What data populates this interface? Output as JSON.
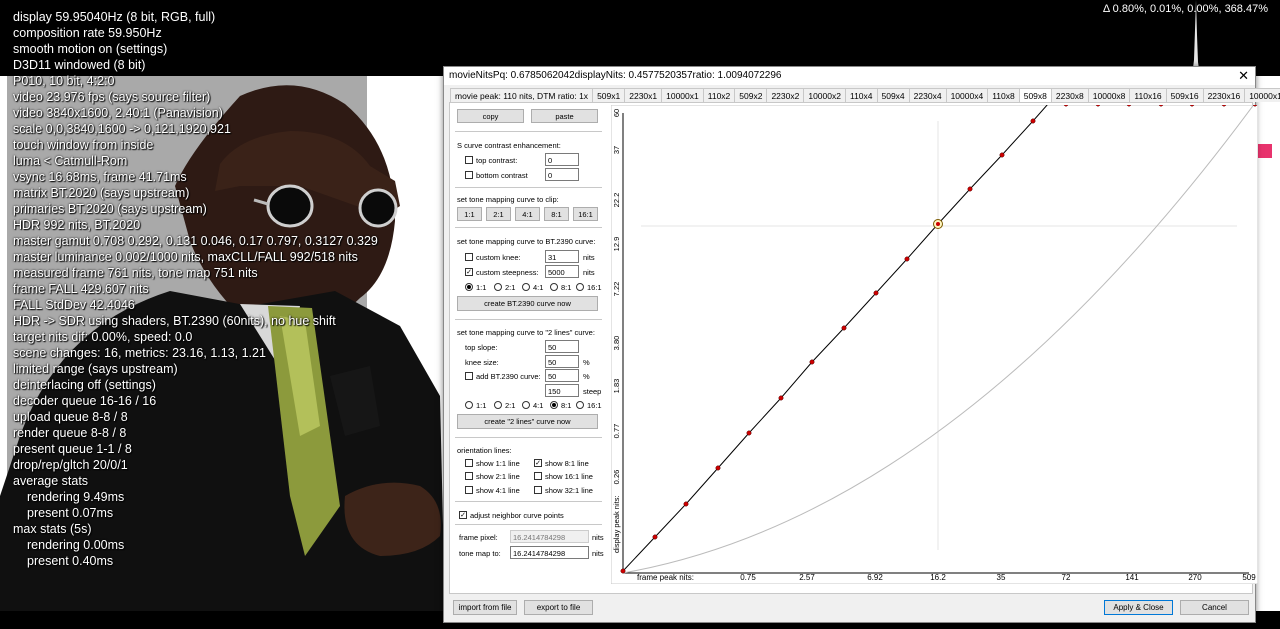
{
  "osd": {
    "lines": [
      "display 59.95040Hz  (8 bit, RGB, full)",
      "composition rate 59.950Hz",
      "smooth motion on (settings)",
      "D3D11 windowed (8 bit)",
      "P010, 10 bit, 4:2:0",
      "video 23.976 fps  (says source filter)",
      "video 3840x1600, 2.40:1 (Panavision)",
      "scale 0,0,3840,1600 -> 0,121,1920,921",
      "touch window from inside",
      "luma < Catmull-Rom",
      "vsync 16.68ms, frame 41.71ms",
      "matrix BT.2020 (says upstream)",
      "primaries BT.2020 (says upstream)",
      "HDR 992 nits, BT.2020",
      "master gamut 0.708 0.292, 0.131 0.046, 0.17 0.797, 0.3127 0.329",
      "master luminance 0.002/1000 nits, maxCLL/FALL 992/518 nits",
      "measured frame 761 nits, tone map 751 nits",
      "frame FALL 429.607 nits",
      "FALL StdDev 42.4046",
      "HDR -> SDR using shaders, BT.2390 (60nits), no hue shift",
      "target nits dif: 0.00%, speed: 0.0",
      "scene changes: 16, metrics: 23.16, 1.13, 1.21",
      "limited range (says upstream)",
      "deinterlacing off (settings)",
      "decoder queue 16-16 / 16",
      "upload queue 8-8 / 8",
      "render queue 8-8 / 8",
      "present queue 1-1 / 8",
      "drop/rep/gltch 20/0/1",
      "average stats",
      "rendering 9.49ms",
      "present 0.07ms",
      "max stats (5s)",
      "rendering 0.00ms",
      "present 0.40ms"
    ],
    "top_right": "Δ 0.80%, 0.01%, 0.00%, 368.47%"
  },
  "dialog": {
    "title": "movieNitsPq: 0.6785062042displayNits: 0.4577520357ratio: 1.0094072296",
    "close_label": "✕",
    "tabs": [
      "movie peak: 110 nits, DTM ratio: 1x",
      "509x1",
      "2230x1",
      "10000x1",
      "110x2",
      "509x2",
      "2230x2",
      "10000x2",
      "110x4",
      "509x4",
      "2230x4",
      "10000x4",
      "110x8",
      "509x8",
      "2230x8",
      "10000x8",
      "110x16",
      "509x16",
      "2230x16",
      "10000x16"
    ],
    "active_tab": "509x8",
    "copy": "copy",
    "paste": "paste",
    "s_curve_title": "S curve contrast enhancement:",
    "top_contrast_label": "top contrast:",
    "top_contrast_value": "0",
    "bottom_contrast_label": "bottom contrast",
    "bottom_contrast_value": "0",
    "clip_title": "set tone mapping curve to clip:",
    "clip_buttons": [
      "1:1",
      "2:1",
      "4:1",
      "8:1",
      "16:1"
    ],
    "bt2390_title": "set tone mapping curve to BT.2390 curve:",
    "custom_knee_label": "custom knee:",
    "custom_knee_value": "31",
    "custom_knee_unit": "nits",
    "custom_steepness_label": "custom steepness:",
    "custom_steepness_value": "5000",
    "custom_steepness_unit": "nits",
    "bt2390_ratios": [
      "1:1",
      "2:1",
      "4:1",
      "8:1",
      "16:1"
    ],
    "create_bt2390": "create BT.2390 curve now",
    "two_lines_title": "set tone mapping curve to \"2 lines\" curve:",
    "top_slope_label": "top slope:",
    "top_slope_value": "50",
    "knee_size_label": "knee size:",
    "knee_size_value": "50",
    "knee_size_unit": "%",
    "add_bt2390_label": "add BT.2390 curve:",
    "add_bt2390_value": "50",
    "add_bt2390_unit": "%",
    "steep_value": "150",
    "steep_unit": "steep",
    "two_lines_ratios": [
      "1:1",
      "2:1",
      "4:1",
      "8:1",
      "16:1"
    ],
    "create_two_lines": "create \"2 lines\" curve now",
    "orientation_title": "orientation lines:",
    "orient": [
      "show 1:1 line",
      "show 8:1 line",
      "show 2:1 line",
      "show 16:1 line",
      "show 4:1 line",
      "show 32:1 line"
    ],
    "adjust_neighbor_label": "adjust neighbor curve points",
    "frame_pixel_label": "frame pixel:",
    "frame_pixel_value": "16.2414784298",
    "frame_pixel_unit": "nits",
    "tone_map_label": "tone map to:",
    "tone_map_value": "16.2414784298",
    "tone_map_unit": "nits",
    "import": "import from file",
    "export": "export to file",
    "apply": "Apply & Close",
    "cancel": "Cancel"
  },
  "chart_data": {
    "type": "line",
    "xlabel": "frame peak nits:",
    "ylabel": "display peak nits:",
    "x_ticks": [
      "0.75",
      "2.57",
      "6.92",
      "16.2",
      "35",
      "72",
      "141",
      "270",
      "509"
    ],
    "y_ticks": [
      "0.26",
      "0.77",
      "1.83",
      "3.80",
      "7.22",
      "12.9",
      "22.2",
      "37",
      "60"
    ],
    "series": [
      {
        "kind": "tone-map-curve",
        "points": [
          [
            0.0,
            0.0
          ],
          [
            0.0,
            0.0
          ],
          [
            0.0,
            0.0
          ]
        ]
      }
    ],
    "grid": false
  },
  "colors": {
    "curve_point": "#cc0000",
    "curve_line": "#000000",
    "reference_line": "#bbbbbb",
    "accent": "#0078d7"
  }
}
